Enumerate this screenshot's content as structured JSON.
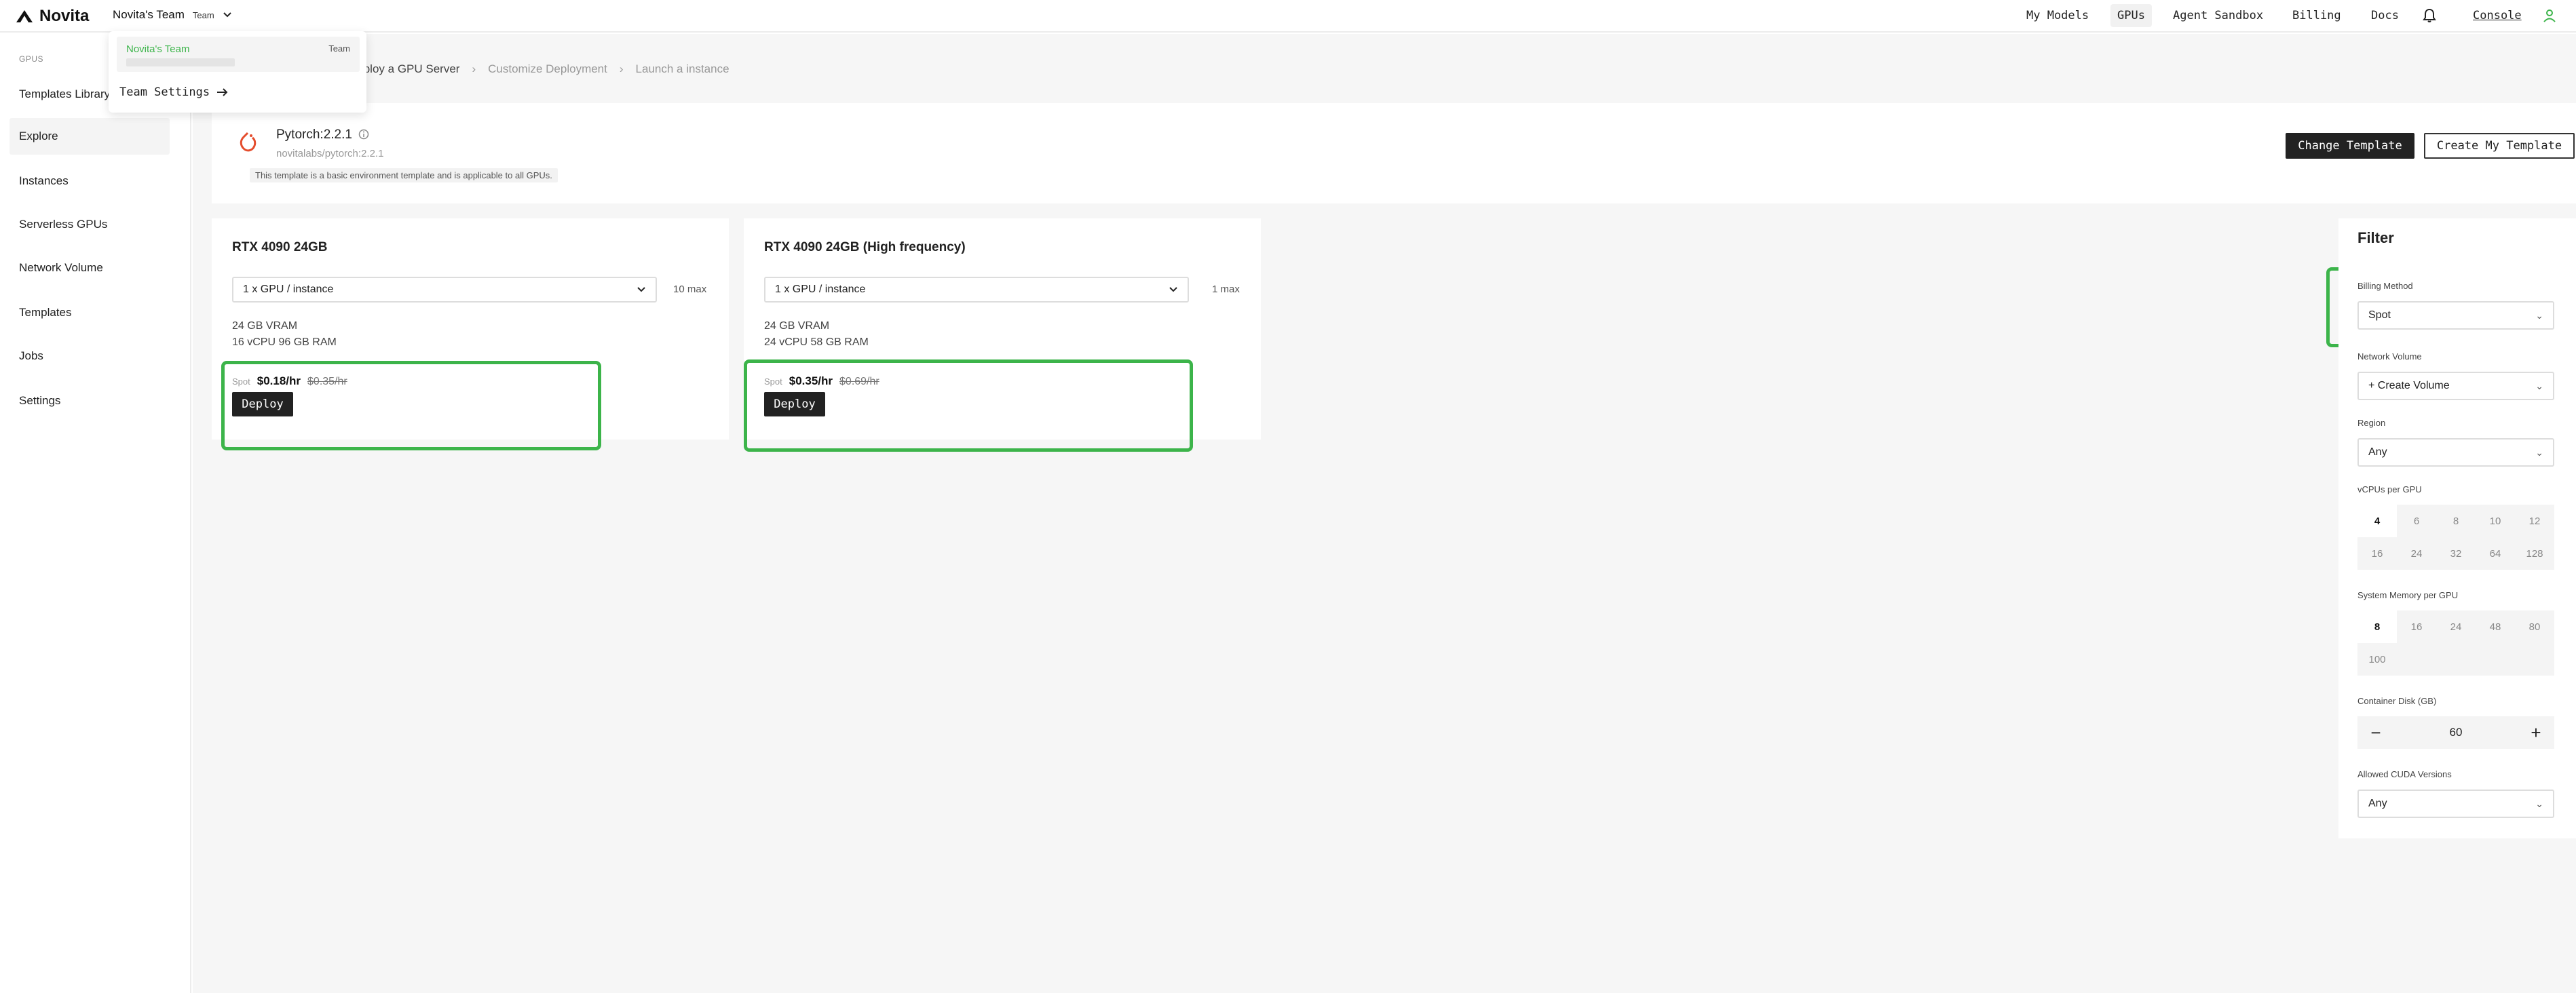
{
  "topbar": {
    "brand": "Novita",
    "team_name": "Novita's Team",
    "team_badge": "Team",
    "nav": [
      "My Models",
      "GPUs",
      "Agent Sandbox",
      "Billing",
      "Docs"
    ],
    "console": "Console"
  },
  "team_menu": {
    "team_name": "Novita's Team",
    "team_type": "Team",
    "settings_label": "Team Settings"
  },
  "sidebar": {
    "section": "GPUS",
    "items": [
      "Templates Library",
      "Explore",
      "Instances",
      "Serverless GPUs",
      "Network Volume",
      "Templates",
      "Jobs",
      "Settings"
    ]
  },
  "breadcrumb": {
    "step1": "Deploy a GPU Server",
    "step2": "Customize Deployment",
    "step3": "Launch a instance"
  },
  "template": {
    "name": "Pytorch:2.2.1",
    "repo": "novitalabs/pytorch:2.2.1",
    "note": "This template is a basic environment template and is applicable to all GPUs.",
    "change_btn": "Change Template",
    "create_btn": "Create My Template"
  },
  "gpus": [
    {
      "title": "RTX 4090 24GB",
      "select": "1 x GPU / instance",
      "max": "10 max",
      "vram": "24 GB VRAM",
      "spec": "16 vCPU 96 GB RAM",
      "spot_label": "Spot",
      "price": "$0.18/hr",
      "old_price": "$0.35/hr",
      "deploy": "Deploy"
    },
    {
      "title": "RTX 4090 24GB (High frequency)",
      "select": "1 x GPU / instance",
      "max": "1 max",
      "vram": "24 GB VRAM",
      "spec": "24 vCPU 58 GB RAM",
      "spot_label": "Spot",
      "price": "$0.35/hr",
      "old_price": "$0.69/hr",
      "deploy": "Deploy"
    }
  ],
  "filter": {
    "title": "Filter",
    "billing_label": "Billing Method",
    "billing_value": "Spot",
    "network_label": "Network Volume",
    "network_value": "+ Create Volume",
    "region_label": "Region",
    "region_value": "Any",
    "vcpu_label": "vCPUs per GPU",
    "vcpu_options": [
      "4",
      "6",
      "8",
      "10",
      "12",
      "16",
      "24",
      "32",
      "64",
      "128"
    ],
    "memory_label": "System Memory per GPU",
    "memory_options": [
      "8",
      "16",
      "24",
      "48",
      "80",
      "100"
    ],
    "disk_label": "Container Disk (GB)",
    "disk_minus": "−",
    "disk_value": "60",
    "disk_plus": "+",
    "cuda_label": "Allowed CUDA Versions",
    "cuda_value": "Any"
  },
  "colors": {
    "accent": "#3cb44a",
    "dark_button": "#222222"
  }
}
